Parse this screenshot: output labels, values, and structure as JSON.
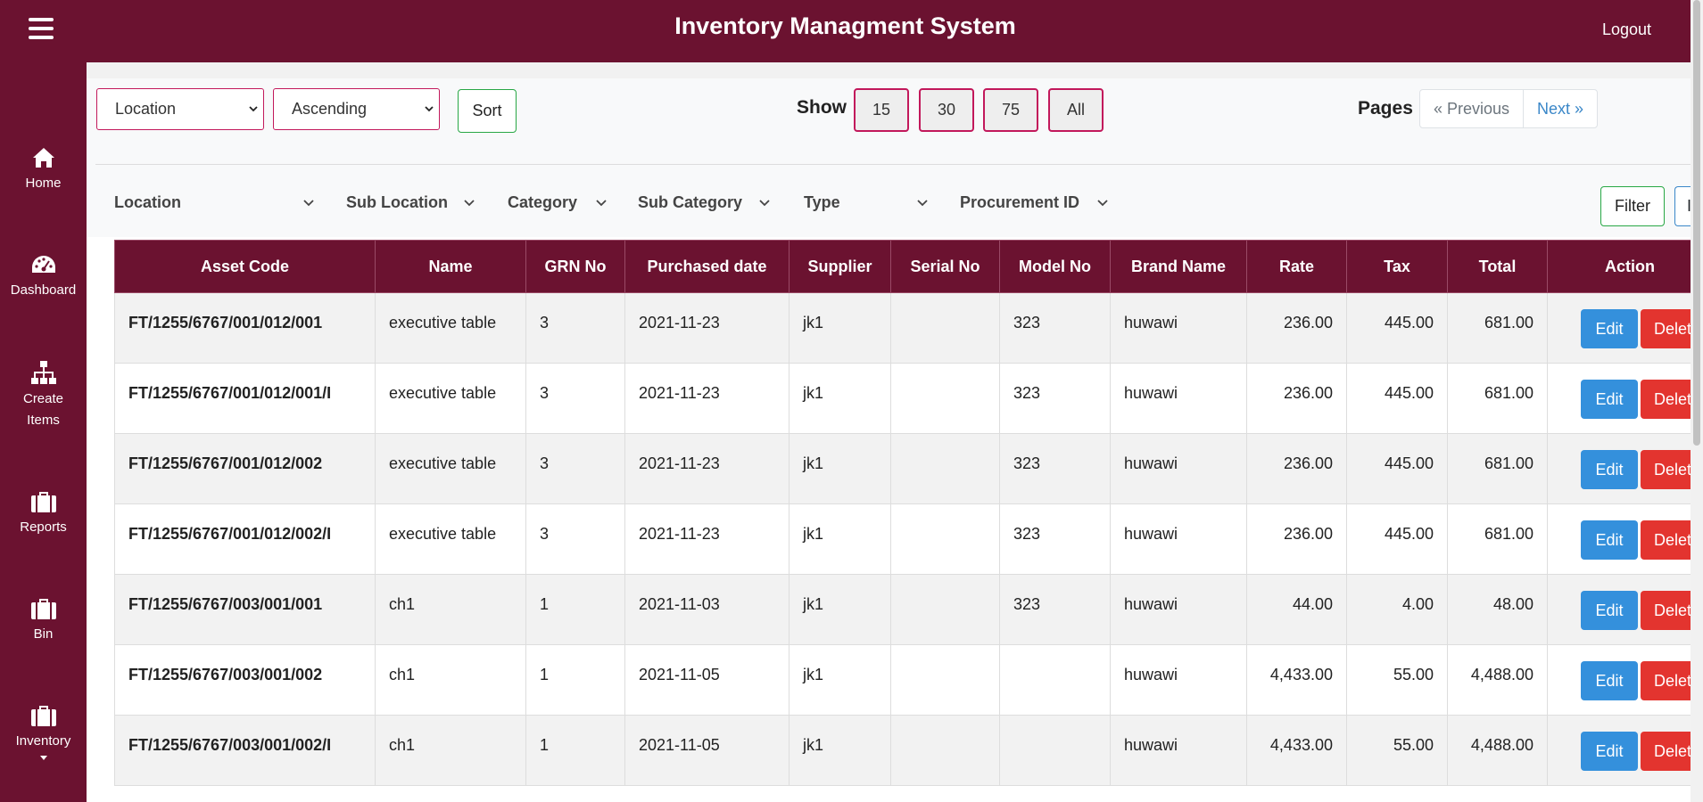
{
  "header": {
    "title": "Inventory Managment System",
    "logout_label": "Logout",
    "menu_icon": "hamburger-icon"
  },
  "sidebar": {
    "items": [
      {
        "label": "Home",
        "icon": "home-icon"
      },
      {
        "label": "Dashboard",
        "icon": "dashboard-icon"
      },
      {
        "label": "Create Items",
        "icon": "sitemap-icon"
      },
      {
        "label": "Reports",
        "icon": "briefcase-icon"
      },
      {
        "label": "Bin",
        "icon": "briefcase-icon"
      },
      {
        "label": "Inventory",
        "icon": "briefcase-icon"
      }
    ]
  },
  "controls": {
    "sort_field": "Location",
    "sort_order": "Ascending",
    "sort_label": "Sort",
    "show_label": "Show",
    "show_options": [
      "15",
      "30",
      "75",
      "All"
    ],
    "pages_label": "Pages",
    "prev_label": "« Previous",
    "next_label": "Next »"
  },
  "filters": {
    "items": [
      "Location",
      "Sub Location",
      "Category",
      "Sub Category",
      "Type",
      "Procurement ID"
    ],
    "filter_label": "Filter",
    "second_label": "I"
  },
  "table": {
    "headers": [
      "Asset Code",
      "Name",
      "GRN No",
      "Purchased date",
      "Supplier",
      "Serial No",
      "Model No",
      "Brand Name",
      "Rate",
      "Tax",
      "Total",
      "Action"
    ],
    "edit_label": "Edit",
    "delete_label": "Delete",
    "rows": [
      {
        "code": "FT/1255/6767/001/012/001",
        "name": "executive table",
        "grn": "3",
        "date": "2021-11-23",
        "supplier": "jk1",
        "serial": "",
        "model": "323",
        "brand": "huwawi",
        "rate": "236.00",
        "tax": "445.00",
        "total": "681.00"
      },
      {
        "code": "FT/1255/6767/001/012/001/I",
        "name": "executive table",
        "grn": "3",
        "date": "2021-11-23",
        "supplier": "jk1",
        "serial": "",
        "model": "323",
        "brand": "huwawi",
        "rate": "236.00",
        "tax": "445.00",
        "total": "681.00"
      },
      {
        "code": "FT/1255/6767/001/012/002",
        "name": "executive table",
        "grn": "3",
        "date": "2021-11-23",
        "supplier": "jk1",
        "serial": "",
        "model": "323",
        "brand": "huwawi",
        "rate": "236.00",
        "tax": "445.00",
        "total": "681.00"
      },
      {
        "code": "FT/1255/6767/001/012/002/I",
        "name": "executive table",
        "grn": "3",
        "date": "2021-11-23",
        "supplier": "jk1",
        "serial": "",
        "model": "323",
        "brand": "huwawi",
        "rate": "236.00",
        "tax": "445.00",
        "total": "681.00"
      },
      {
        "code": "FT/1255/6767/003/001/001",
        "name": "ch1",
        "grn": "1",
        "date": "2021-11-03",
        "supplier": "jk1",
        "serial": "",
        "model": "323",
        "brand": "huwawi",
        "rate": "44.00",
        "tax": "4.00",
        "total": "48.00"
      },
      {
        "code": "FT/1255/6767/003/001/002",
        "name": "ch1",
        "grn": "1",
        "date": "2021-11-05",
        "supplier": "jk1",
        "serial": "",
        "model": "",
        "brand": "huwawi",
        "rate": "4,433.00",
        "tax": "55.00",
        "total": "4,488.00"
      },
      {
        "code": "FT/1255/6767/003/001/002/I",
        "name": "ch1",
        "grn": "1",
        "date": "2021-11-05",
        "supplier": "jk1",
        "serial": "",
        "model": "",
        "brand": "huwawi",
        "rate": "4,433.00",
        "tax": "55.00",
        "total": "4,488.00"
      }
    ]
  },
  "colors": {
    "brand": "#6b1230",
    "edit": "#3490dc",
    "delete": "#e3342f",
    "accent_border": "#c2185b",
    "success_border": "#28a745"
  }
}
